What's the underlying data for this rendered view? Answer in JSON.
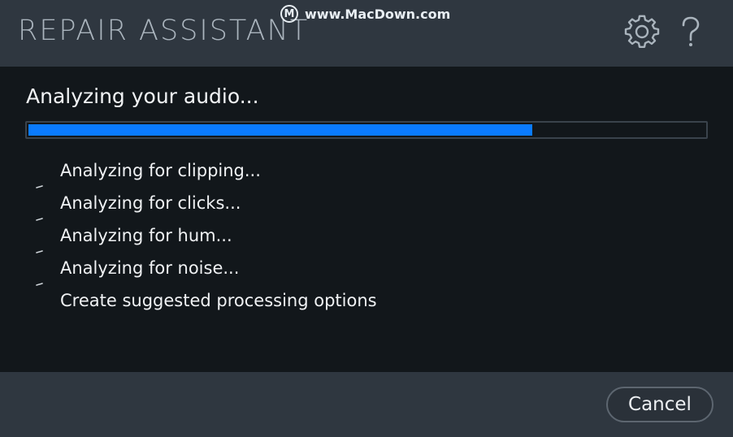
{
  "header": {
    "title": "REPAIR ASSISTANT",
    "watermark_text": "www.MacDown.com",
    "watermark_mark": "M",
    "icons": [
      "gear-icon",
      "help-icon"
    ]
  },
  "main": {
    "status": "Analyzing your audio...",
    "progress_fraction": 0.745,
    "progress_color": "#0a7bff",
    "steps": [
      {
        "label": "Analyzing for clipping...",
        "active": true
      },
      {
        "label": "Analyzing for clicks...",
        "active": true
      },
      {
        "label": "Analyzing for hum...",
        "active": true
      },
      {
        "label": "Analyzing for noise...",
        "active": true
      },
      {
        "label": "Create suggested processing options",
        "active": false
      }
    ]
  },
  "footer": {
    "cancel_label": "Cancel"
  }
}
